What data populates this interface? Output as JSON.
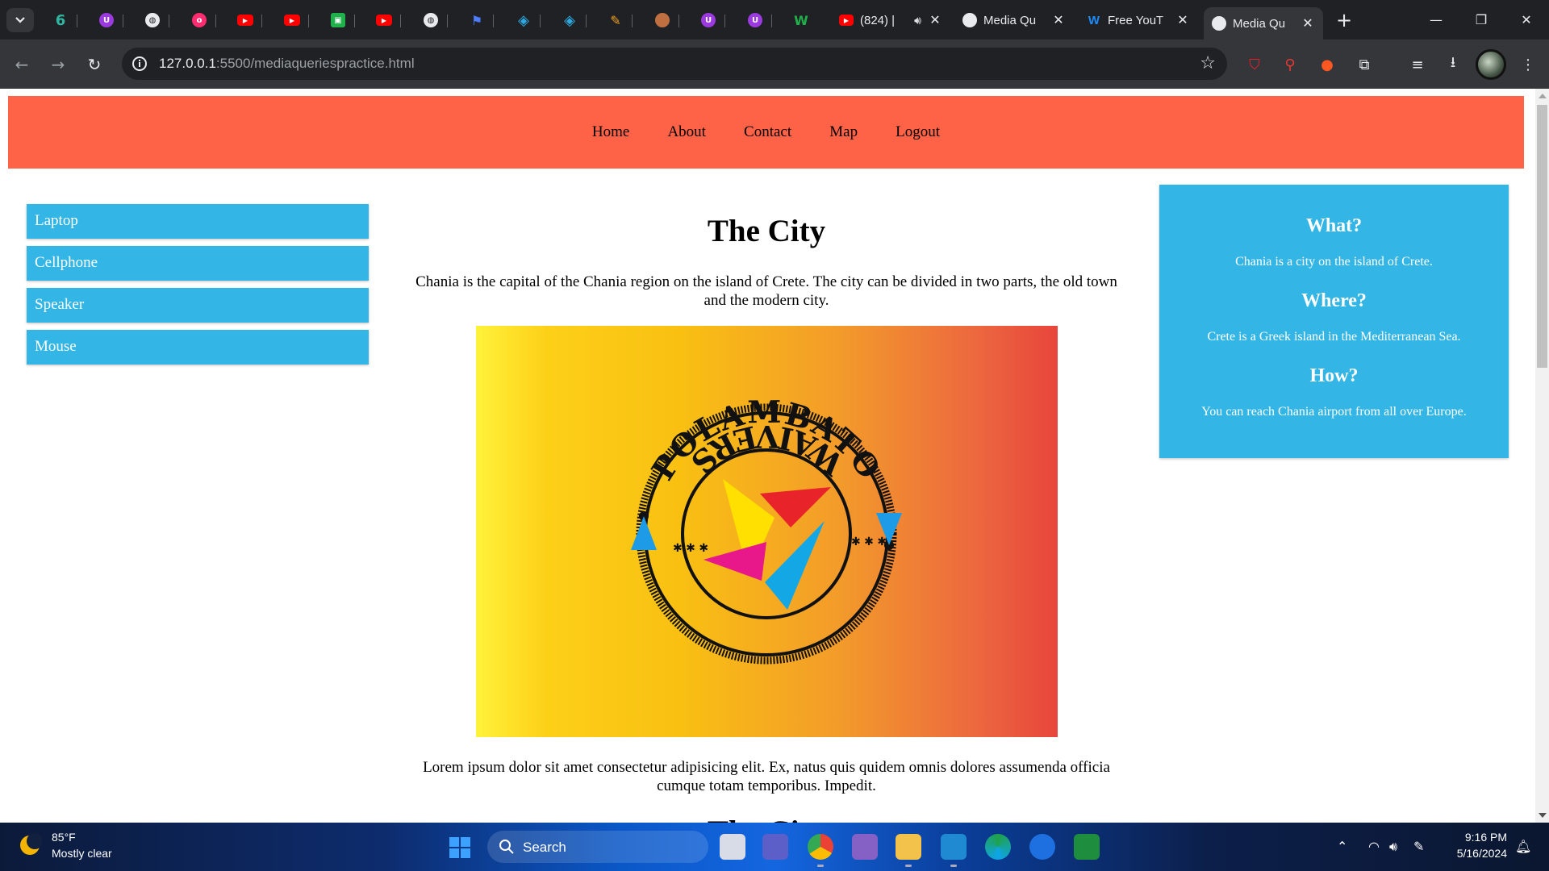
{
  "browser": {
    "pinned_tabs": [
      {
        "icon": "threads-icon",
        "color": "#2fb6a3"
      },
      {
        "icon": "ublock-icon",
        "color": "#9b3ae0"
      },
      {
        "icon": "globe-icon",
        "color": "#e8eaed"
      },
      {
        "icon": "ideabox-icon",
        "color": "#ff2d6f"
      },
      {
        "icon": "youtube-icon",
        "color": "#ff0000"
      },
      {
        "icon": "youtube-icon",
        "color": "#ff0000"
      },
      {
        "icon": "green-app-icon",
        "color": "#1fb24a"
      },
      {
        "icon": "youtube-icon",
        "color": "#ff0000"
      },
      {
        "icon": "globe-icon",
        "color": "#e8eaed"
      },
      {
        "icon": "flag-icon",
        "color": "#4d7cff"
      },
      {
        "icon": "drupal-icon",
        "color": "#2ba9e0"
      },
      {
        "icon": "drupal-icon",
        "color": "#2ba9e0"
      },
      {
        "icon": "feather-icon",
        "color": "#f0a020"
      },
      {
        "icon": "avatar-icon",
        "color": "#c07040"
      },
      {
        "icon": "ublock-icon",
        "color": "#9b3ae0"
      },
      {
        "icon": "ublock-icon",
        "color": "#9b3ae0"
      },
      {
        "icon": "webflow-icon",
        "color": "#1fb24a"
      }
    ],
    "tabs": [
      {
        "title": "(824) |",
        "icon": "youtube-icon",
        "audio": true,
        "active": false
      },
      {
        "title": "Media Qu",
        "icon": "globe-icon",
        "audio": false,
        "active": false
      },
      {
        "title": "Free YouT",
        "icon": "w-icon",
        "audio": false,
        "active": false
      },
      {
        "title": "Media Qu",
        "icon": "globe-icon",
        "audio": false,
        "active": true
      }
    ],
    "new_tab_label": "+",
    "url_host": "127.0.0.1",
    "url_path": ":5500/mediaqueriespractice.html"
  },
  "page": {
    "nav": [
      "Home",
      "About",
      "Contact",
      "Map",
      "Logout"
    ],
    "menu": [
      "Laptop",
      "Cellphone",
      "Speaker",
      "Mouse"
    ],
    "heading": "The City",
    "intro": "Chania is the capital of the Chania region on the island of Crete. The city can be divided in two parts, the old town and the modern city.",
    "logo_text_top": "POLAMBATO",
    "logo_text_bottom": "WAIVERS",
    "paragraph2": "Lorem ipsum dolor sit amet consectetur adipisicing elit. Ex, natus quis quidem omnis dolores assumenda officia cumque totam temporibus. Impedit.",
    "heading2": "The City",
    "aside": [
      {
        "title": "What?",
        "text": "Chania is a city on the island of Crete."
      },
      {
        "title": "Where?",
        "text": "Crete is a Greek island in the Mediterranean Sea."
      },
      {
        "title": "How?",
        "text": "You can reach Chania airport from all over Europe."
      }
    ],
    "colors": {
      "header": "#ff6347",
      "menu": "#33b5e5",
      "aside": "#33b5e5"
    }
  },
  "taskbar": {
    "weather_temp": "85°F",
    "weather_desc": "Mostly clear",
    "search_label": "Search",
    "time": "9:16 PM",
    "date": "5/16/2024",
    "apps": [
      "task-view-icon",
      "teams-icon",
      "chrome-icon",
      "visual-studio-icon",
      "file-explorer-icon",
      "vscode-icon",
      "edge-icon",
      "firefox-icon",
      "classroom-icon"
    ]
  }
}
